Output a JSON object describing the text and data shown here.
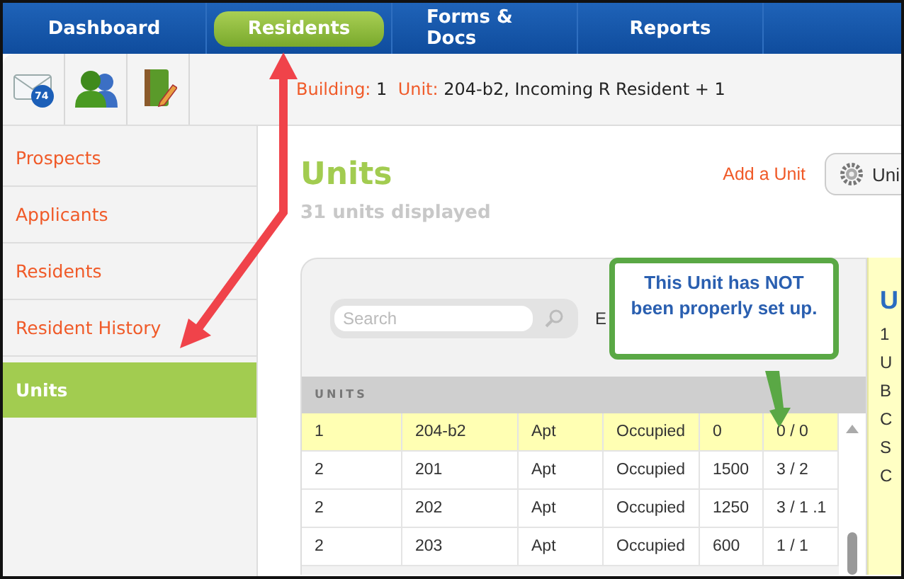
{
  "nav_tabs": [
    {
      "label": "Dashboard",
      "selected": false
    },
    {
      "label": "Residents",
      "selected": true
    },
    {
      "label": "Forms & Docs",
      "selected": false
    },
    {
      "label": "Reports",
      "selected": false
    }
  ],
  "toolbar_icons": [
    {
      "kind": "mail",
      "badge": "74"
    },
    {
      "kind": "people"
    },
    {
      "kind": "notebook"
    }
  ],
  "context": {
    "building_label": "Building:",
    "building": "1",
    "unit_label": "Unit:",
    "unit": "204-b2, Incoming R Resident + 1"
  },
  "sidebar": [
    {
      "label": "Prospects",
      "selected": false
    },
    {
      "label": "Applicants",
      "selected": false
    },
    {
      "label": "Residents",
      "selected": false
    },
    {
      "label": "Resident History",
      "selected": false
    },
    {
      "label": "Units",
      "selected": true
    }
  ],
  "page": {
    "title": "Units",
    "subtitle": "31 units displayed",
    "add_link": "Add a Unit",
    "action_button": "Uni"
  },
  "units_panel": {
    "search_placeholder": "Search",
    "cut_label": "E",
    "header": "UNITS",
    "rows": [
      {
        "cells": [
          "1",
          "204-b2",
          "Apt",
          "Occupied",
          "0",
          "0 / 0"
        ],
        "selected": true
      },
      {
        "cells": [
          "2",
          "201",
          "Apt",
          "Occupied",
          "1500",
          "3 / 2"
        ],
        "selected": false
      },
      {
        "cells": [
          "2",
          "202",
          "Apt",
          "Occupied",
          "1250",
          "3 / 1 .1"
        ],
        "selected": false
      },
      {
        "cells": [
          "2",
          "203",
          "Apt",
          "Occupied",
          "600",
          "1 / 1"
        ],
        "selected": false
      }
    ]
  },
  "detail_panel": {
    "title": "U",
    "lines": [
      "1",
      "U",
      "B",
      "C",
      "S",
      "C"
    ]
  },
  "callout": {
    "text": "This Unit has NOT been properly set up."
  }
}
